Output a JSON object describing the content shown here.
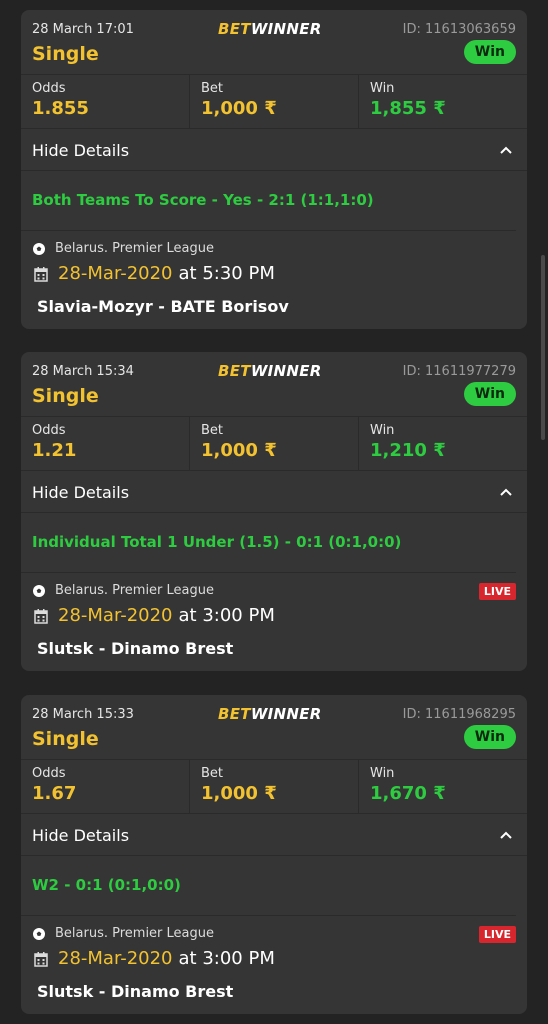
{
  "brand": {
    "part1": "BET",
    "part2": "WINNER"
  },
  "labels": {
    "odds": "Odds",
    "bet": "Bet",
    "win": "Win",
    "hide_details": "Hide Details"
  },
  "bets": [
    {
      "date": "28 March 17:01",
      "id": "ID: 11613063659",
      "type": "Single",
      "status": "Win",
      "odds": "1.855",
      "bet": "1,000 ₹",
      "win": "1,855 ₹",
      "market": "Both Teams To Score - Yes - 2:1 (1:1,1:0)",
      "league": "Belarus. Premier League",
      "live": "",
      "event_date": "28-Mar-2020",
      "event_time": "at 5:30 PM",
      "teams": "Slavia-Mozyr - BATE Borisov"
    },
    {
      "date": "28 March 15:34",
      "id": "ID: 11611977279",
      "type": "Single",
      "status": "Win",
      "odds": "1.21",
      "bet": "1,000 ₹",
      "win": "1,210 ₹",
      "market": "Individual Total 1 Under (1.5) - 0:1 (0:1,0:0)",
      "league": "Belarus. Premier League",
      "live": "LIVE",
      "event_date": "28-Mar-2020",
      "event_time": "at 3:00 PM",
      "teams": "Slutsk - Dinamo Brest"
    },
    {
      "date": "28 March 15:33",
      "id": "ID: 11611968295",
      "type": "Single",
      "status": "Win",
      "odds": "1.67",
      "bet": "1,000 ₹",
      "win": "1,670 ₹",
      "market": "W2 - 0:1 (0:1,0:0)",
      "league": "Belarus. Premier League",
      "live": "LIVE",
      "event_date": "28-Mar-2020",
      "event_time": "at 3:00 PM",
      "teams": "Slutsk - Dinamo Brest"
    }
  ],
  "colors": {
    "background": "#232323",
    "card": "#353535",
    "accent_yellow": "#f2c230",
    "win_green": "#2ecc40",
    "live_red": "#d8262e"
  }
}
